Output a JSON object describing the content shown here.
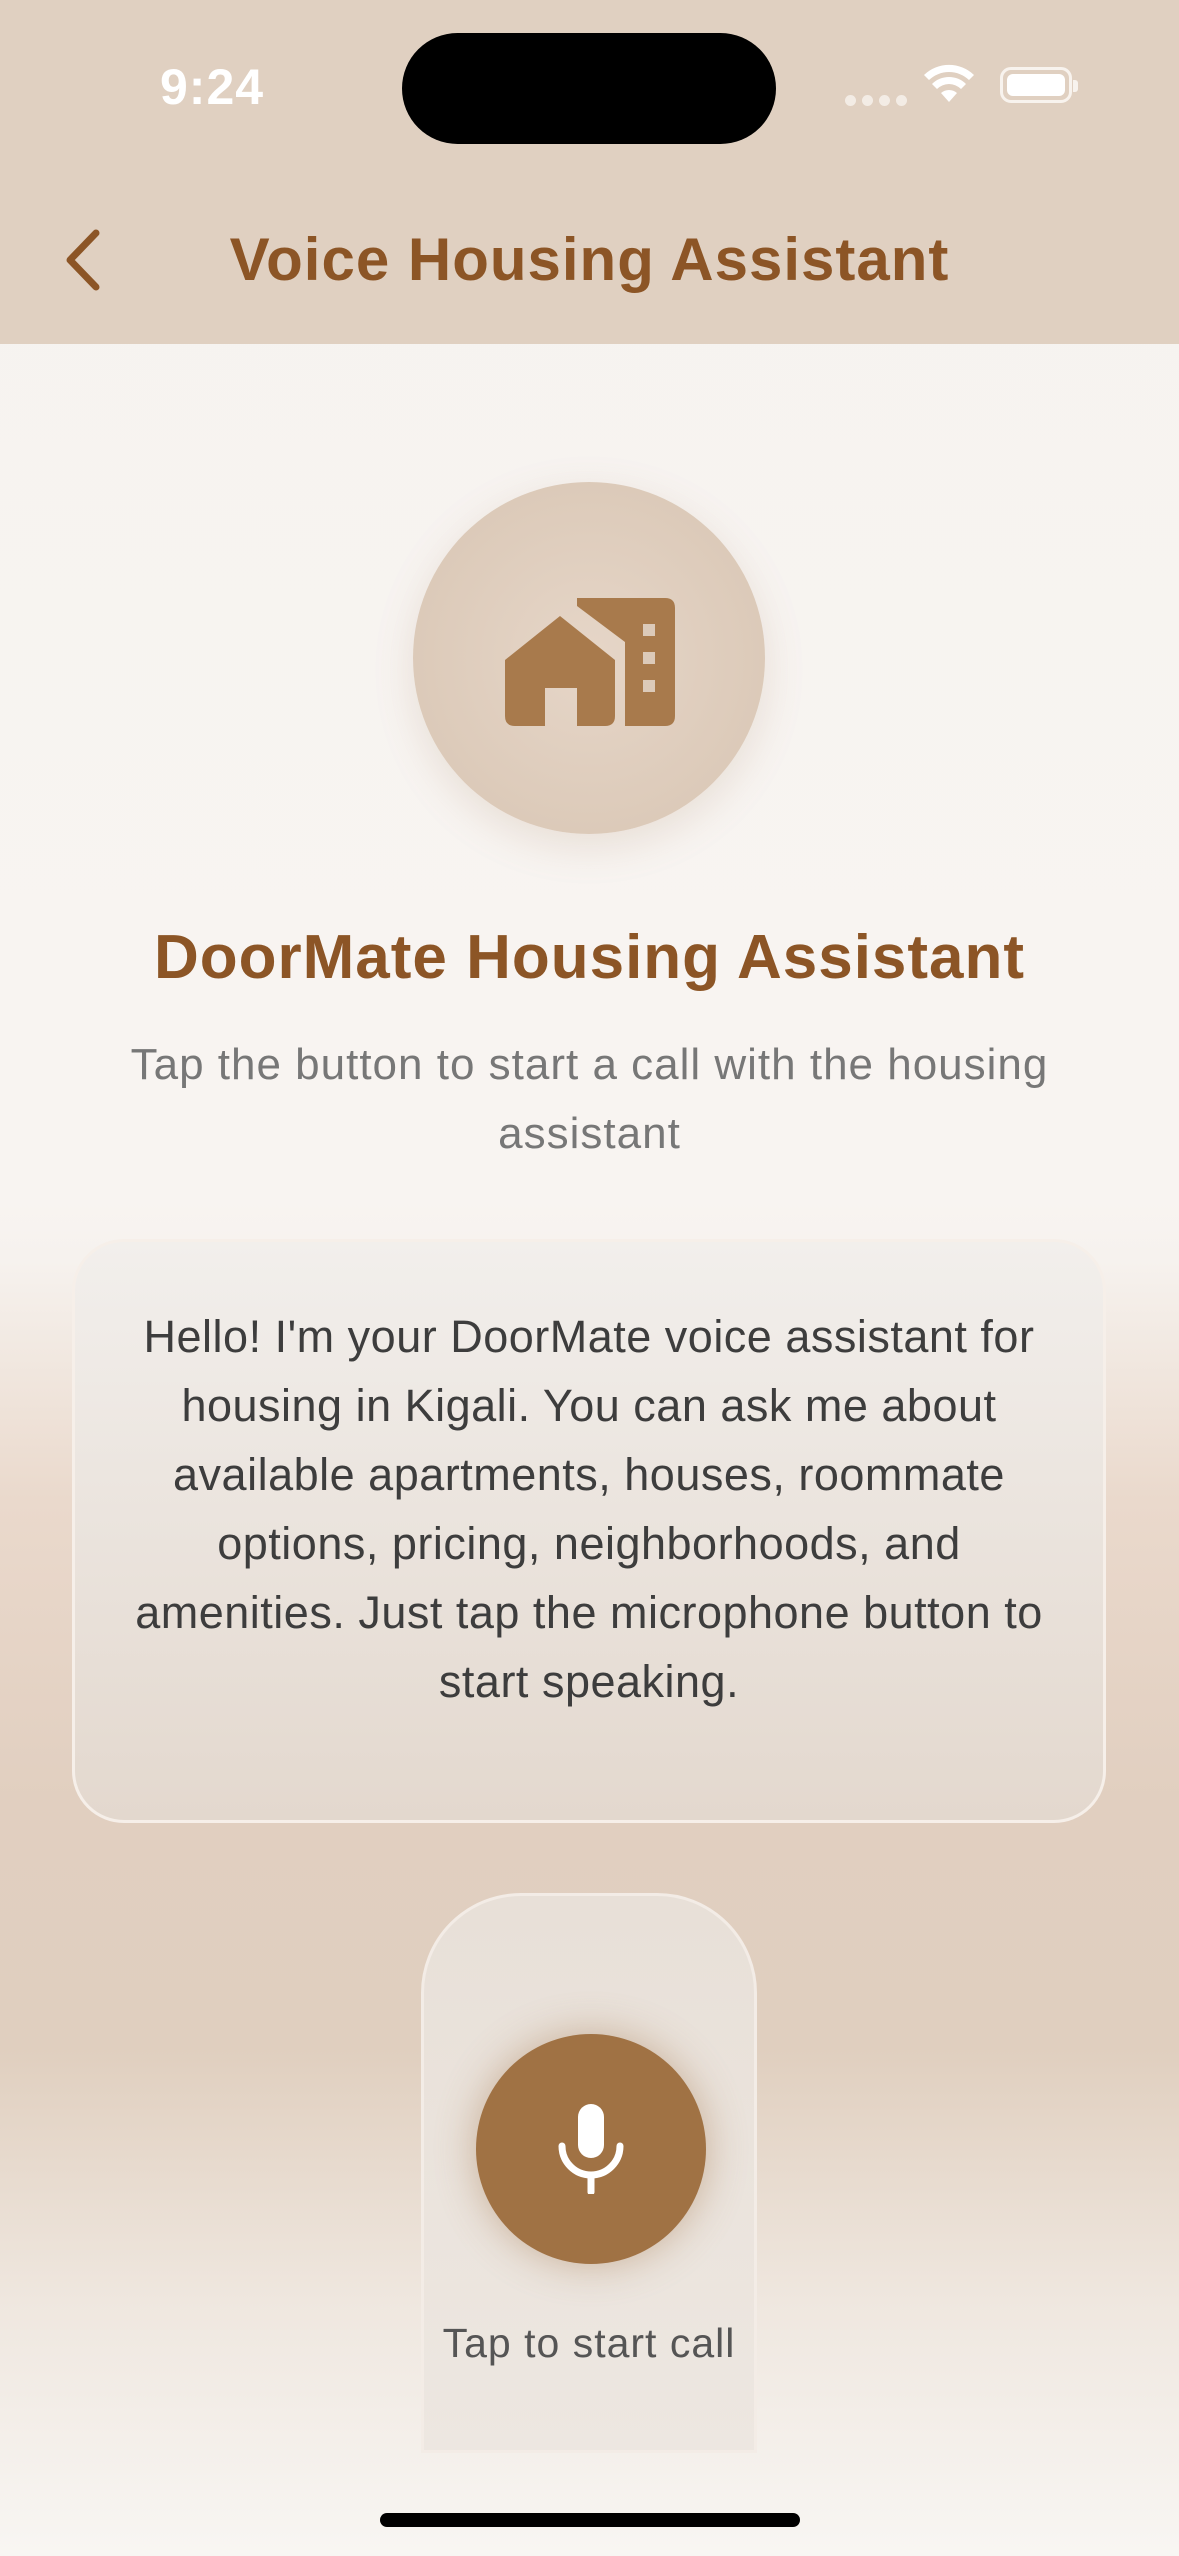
{
  "status_bar": {
    "time": "9:24",
    "icons": [
      "signal-dots-icon",
      "wifi-icon",
      "battery-icon"
    ]
  },
  "nav": {
    "back_icon": "chevron-left-icon",
    "title": "Voice Housing Assistant"
  },
  "hero": {
    "icon": "house-building-icon",
    "title": "DoorMate Housing Assistant",
    "subtitle": "Tap the button to start a call with the housing assistant"
  },
  "message": {
    "text": "Hello! I'm your DoorMate voice assistant for housing in Kigali. You can ask me about available apartments, houses, roommate options, pricing, neighborhoods, and amenities. Just tap the microphone button to start speaking."
  },
  "call": {
    "icon": "microphone-icon",
    "label": "Tap to start call"
  },
  "colors": {
    "accent": "#8c5526",
    "button": "#a07244",
    "header_bg": "#e0d0c1"
  }
}
